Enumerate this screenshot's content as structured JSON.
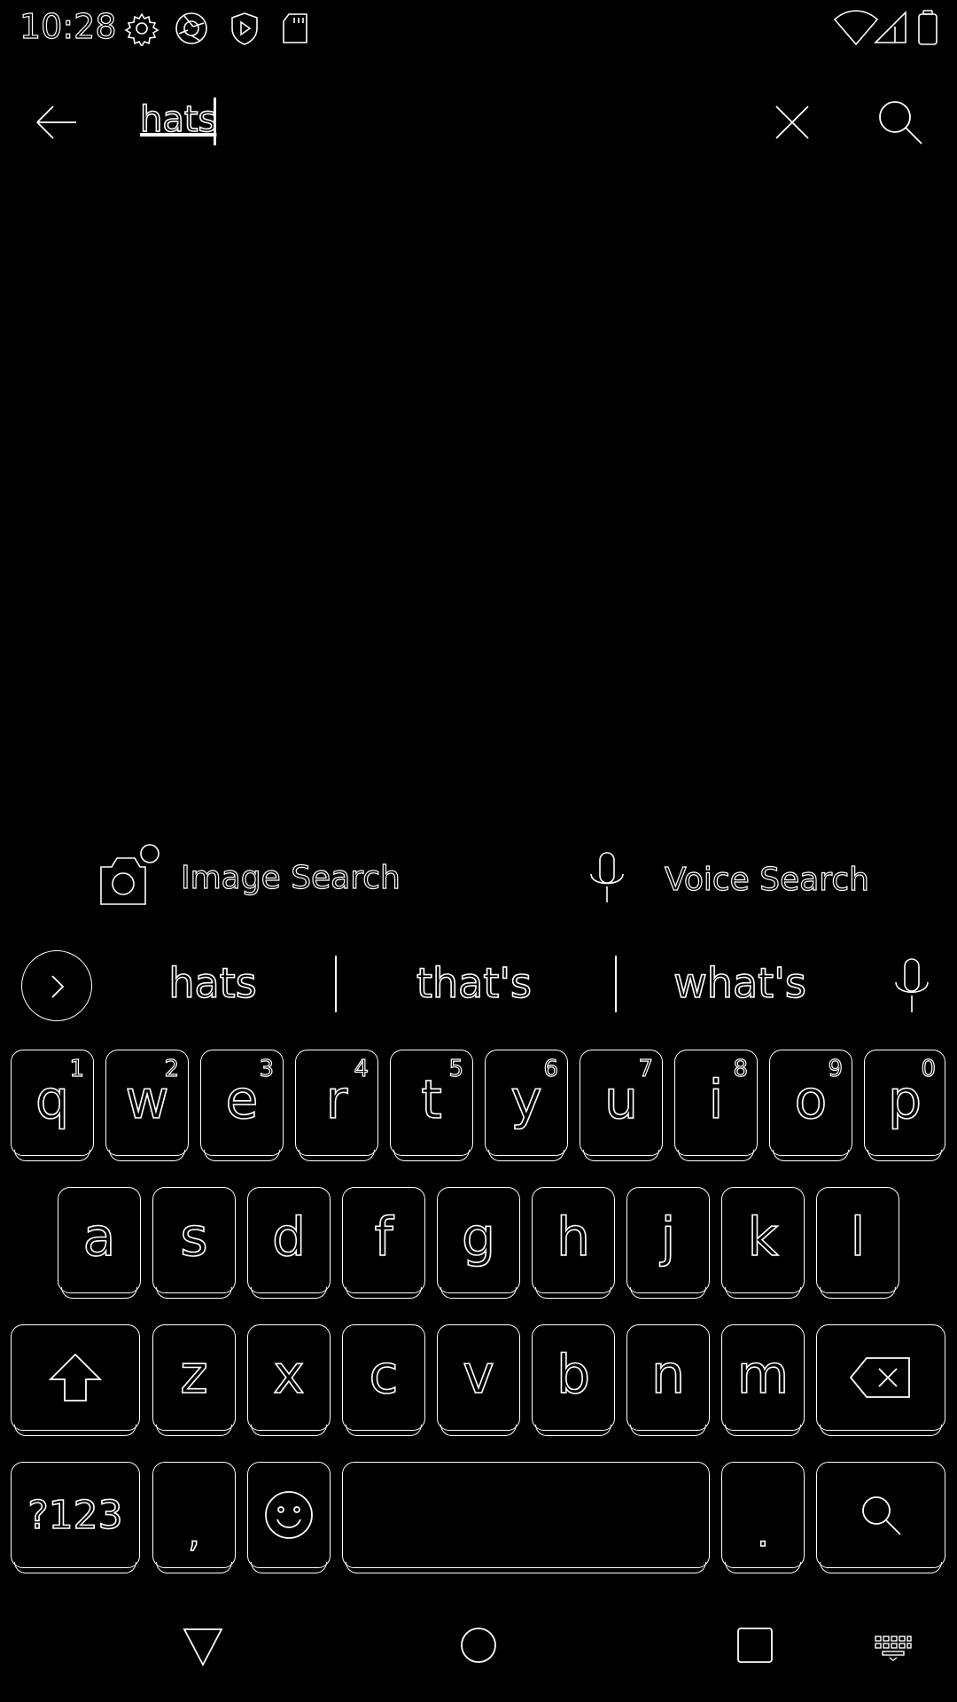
{
  "status_bar": {
    "time": "10:28",
    "icons_left": [
      "settings-icon",
      "camera-shutter-icon",
      "shield-play-icon",
      "sd-card-icon"
    ],
    "icons_right": [
      "wifi-icon",
      "signal-icon",
      "battery-icon"
    ]
  },
  "search": {
    "query": "hats",
    "back_icon": "arrow-left-icon",
    "clear_icon": "close-icon",
    "search_icon": "search-icon"
  },
  "actions": {
    "image_search_label": "Image Search",
    "voice_search_label": "Voice Search"
  },
  "suggestions": [
    "hats",
    "that's",
    "what's"
  ],
  "keyboard": {
    "row1": [
      {
        "key": "q",
        "hint": "1"
      },
      {
        "key": "w",
        "hint": "2"
      },
      {
        "key": "e",
        "hint": "3"
      },
      {
        "key": "r",
        "hint": "4"
      },
      {
        "key": "t",
        "hint": "5"
      },
      {
        "key": "y",
        "hint": "6"
      },
      {
        "key": "u",
        "hint": "7"
      },
      {
        "key": "i",
        "hint": "8"
      },
      {
        "key": "o",
        "hint": "9"
      },
      {
        "key": "p",
        "hint": "0"
      }
    ],
    "row2": [
      "a",
      "s",
      "d",
      "f",
      "g",
      "h",
      "j",
      "k",
      "l"
    ],
    "row3": [
      "z",
      "x",
      "c",
      "v",
      "b",
      "n",
      "m"
    ],
    "symbols_label": "?123",
    "comma": ",",
    "period": "."
  },
  "nav_bar": {
    "icons": [
      "back-triangle-icon",
      "home-circle-icon",
      "recents-square-icon",
      "keyboard-switch-icon"
    ]
  }
}
